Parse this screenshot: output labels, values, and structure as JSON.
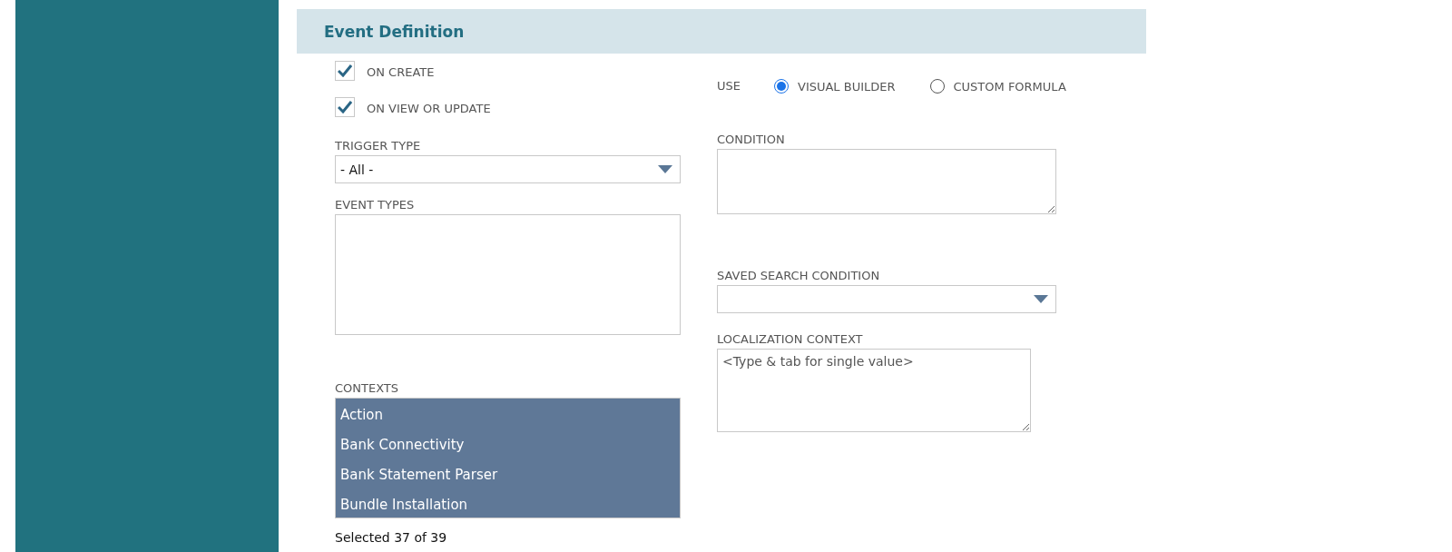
{
  "section": {
    "title": "Event Definition"
  },
  "triggers": [
    {
      "label": "ON CREATE",
      "checked": true
    },
    {
      "label": "ON VIEW OR UPDATE",
      "checked": true
    }
  ],
  "trigger_type": {
    "label": "TRIGGER TYPE",
    "value": "- All -"
  },
  "event_types": {
    "label": "EVENT TYPES"
  },
  "contexts": {
    "label": "CONTEXTS",
    "items": [
      {
        "label": "Action",
        "selected": true
      },
      {
        "label": "Bank Connectivity",
        "selected": true
      },
      {
        "label": "Bank Statement Parser",
        "selected": true
      },
      {
        "label": "Bundle Installation",
        "selected": true
      }
    ],
    "summary": "Selected 37 of 39"
  },
  "use": {
    "label": "USE",
    "options": [
      {
        "label": "VISUAL BUILDER",
        "selected": true
      },
      {
        "label": "CUSTOM FORMULA",
        "selected": false
      }
    ]
  },
  "condition": {
    "label": "CONDITION"
  },
  "saved_search": {
    "label": "SAVED SEARCH CONDITION"
  },
  "localization": {
    "label": "LOCALIZATION CONTEXT",
    "placeholder": "<Type & tab for single value>"
  }
}
